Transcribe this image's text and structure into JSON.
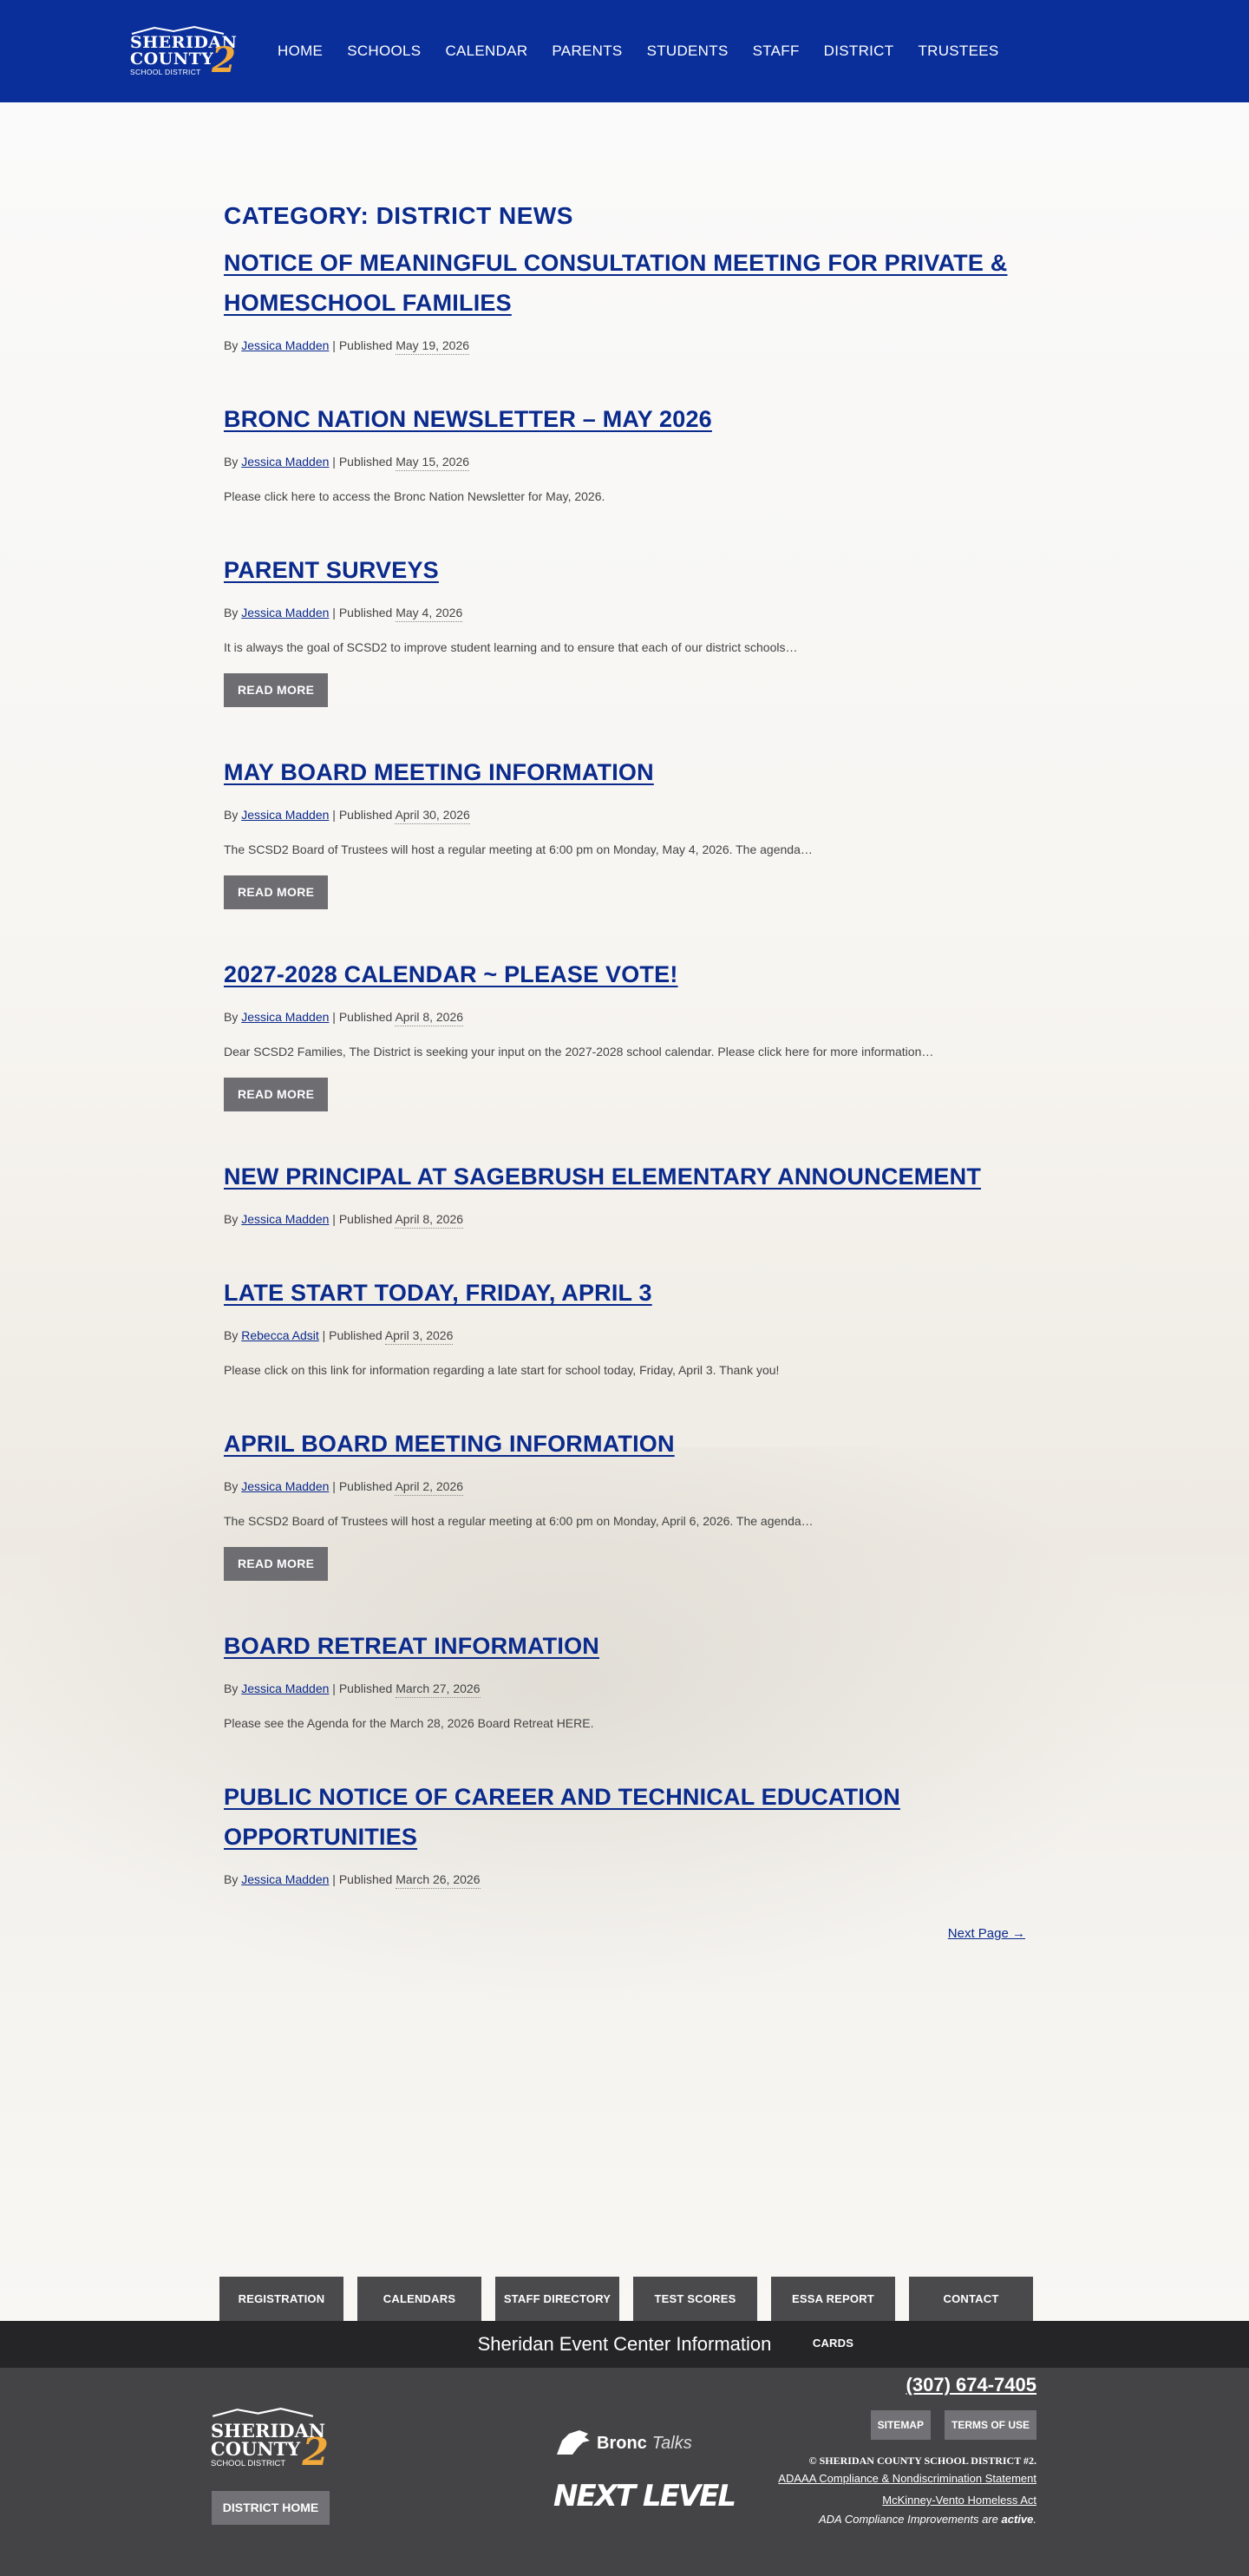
{
  "logo": {
    "line1": "SHERIDAN",
    "line2": "COUNTY",
    "line3": "SCHOOL DISTRICT",
    "number": "2"
  },
  "nav": [
    "HOME",
    "SCHOOLS",
    "CALENDAR",
    "PARENTS",
    "STUDENTS",
    "STAFF",
    "DISTRICT",
    "TRUSTEES"
  ],
  "category_title": "CATEGORY: DISTRICT NEWS",
  "meta_labels": {
    "by": "By",
    "published": "| Published"
  },
  "read_more_label": "READ MORE",
  "posts": [
    {
      "title": "NOTICE OF MEANINGFUL CONSULTATION MEETING FOR PRIVATE & HOMESCHOOL FAMILIES",
      "author": "Jessica Madden",
      "date": "May 19, 2026",
      "excerpt": "",
      "read_more": false
    },
    {
      "title": "BRONC NATION NEWSLETTER – MAY 2026",
      "author": "Jessica Madden",
      "date": "May 15, 2026",
      "excerpt": "Please click here to access the Bronc Nation Newsletter for May, 2026.",
      "read_more": false
    },
    {
      "title": "PARENT SURVEYS",
      "author": "Jessica Madden",
      "date": "May 4, 2026",
      "excerpt": "It is always the goal of SCSD2 to improve student learning and to ensure that each of our district schools…",
      "read_more": true
    },
    {
      "title": "MAY BOARD MEETING INFORMATION",
      "author": "Jessica Madden",
      "date": "April 30, 2026",
      "excerpt": "The SCSD2 Board of Trustees will host a regular meeting at 6:00 pm on Monday, May 4, 2026. The agenda…",
      "read_more": true
    },
    {
      "title": "2027-2028 CALENDAR ~ PLEASE VOTE!",
      "author": "Jessica Madden",
      "date": "April 8, 2026",
      "excerpt": "Dear SCSD2 Families, The District is seeking your input on the 2027-2028 school calendar. Please click here for more information…",
      "read_more": true
    },
    {
      "title": "NEW PRINCIPAL AT SAGEBRUSH ELEMENTARY ANNOUNCEMENT",
      "author": "Jessica Madden",
      "date": "April 8, 2026",
      "excerpt": "",
      "read_more": false
    },
    {
      "title": "LATE START TODAY, FRIDAY, APRIL 3",
      "author": "Rebecca Adsit",
      "date": "April 3, 2026",
      "excerpt": "Please click on this link for information regarding a late start for school  today, Friday, April 3. Thank you!",
      "read_more": false
    },
    {
      "title": "APRIL BOARD MEETING INFORMATION",
      "author": "Jessica Madden",
      "date": "April 2, 2026",
      "excerpt": "The SCSD2 Board of Trustees will host a regular meeting at 6:00 pm on Monday, April 6, 2026. The agenda…",
      "read_more": true
    },
    {
      "title": "BOARD RETREAT INFORMATION",
      "author": "Jessica Madden",
      "date": "March 27, 2026",
      "excerpt": "Please see the Agenda for the March 28, 2026 Board Retreat HERE.",
      "read_more": false
    },
    {
      "title": "PUBLIC NOTICE OF CAREER AND TECHNICAL EDUCATION OPPORTUNITIES",
      "author": "Jessica Madden",
      "date": "March 26, 2026",
      "excerpt": "",
      "read_more": false
    }
  ],
  "next_page": "Next Page →",
  "quick_links": [
    "REGISTRATION",
    "CALENDARS",
    "STAFF DIRECTORY",
    "TEST SCORES",
    "ESSA REPORT CARDS",
    "CONTACT"
  ],
  "event_strip": "Sheridan Event Center Information",
  "footer": {
    "district_home": "DISTRICT HOME",
    "bronc_word1": "Bronc",
    "bronc_word2": "Talks",
    "next_level": "NEXT LEVEL",
    "phone": "(307) 674-7405",
    "sitemap": "SITEMAP",
    "terms": "TERMS OF USE",
    "copyright": "© SHERIDAN COUNTY SCHOOL DISTRICT #2.",
    "link1": "ADAAA Compliance & Nondiscrimination Statement",
    "link2": "McKinney-Vento Homeless Act",
    "ada_prefix": "ADA Compliance Improvements are",
    "ada_bold": "active",
    "ada_suffix": "."
  },
  "colors": {
    "header": "#0a2f9b",
    "link": "#0a2a8c",
    "accent": "#f2a93b",
    "button": "#6d6d72",
    "footer": "#444446"
  }
}
